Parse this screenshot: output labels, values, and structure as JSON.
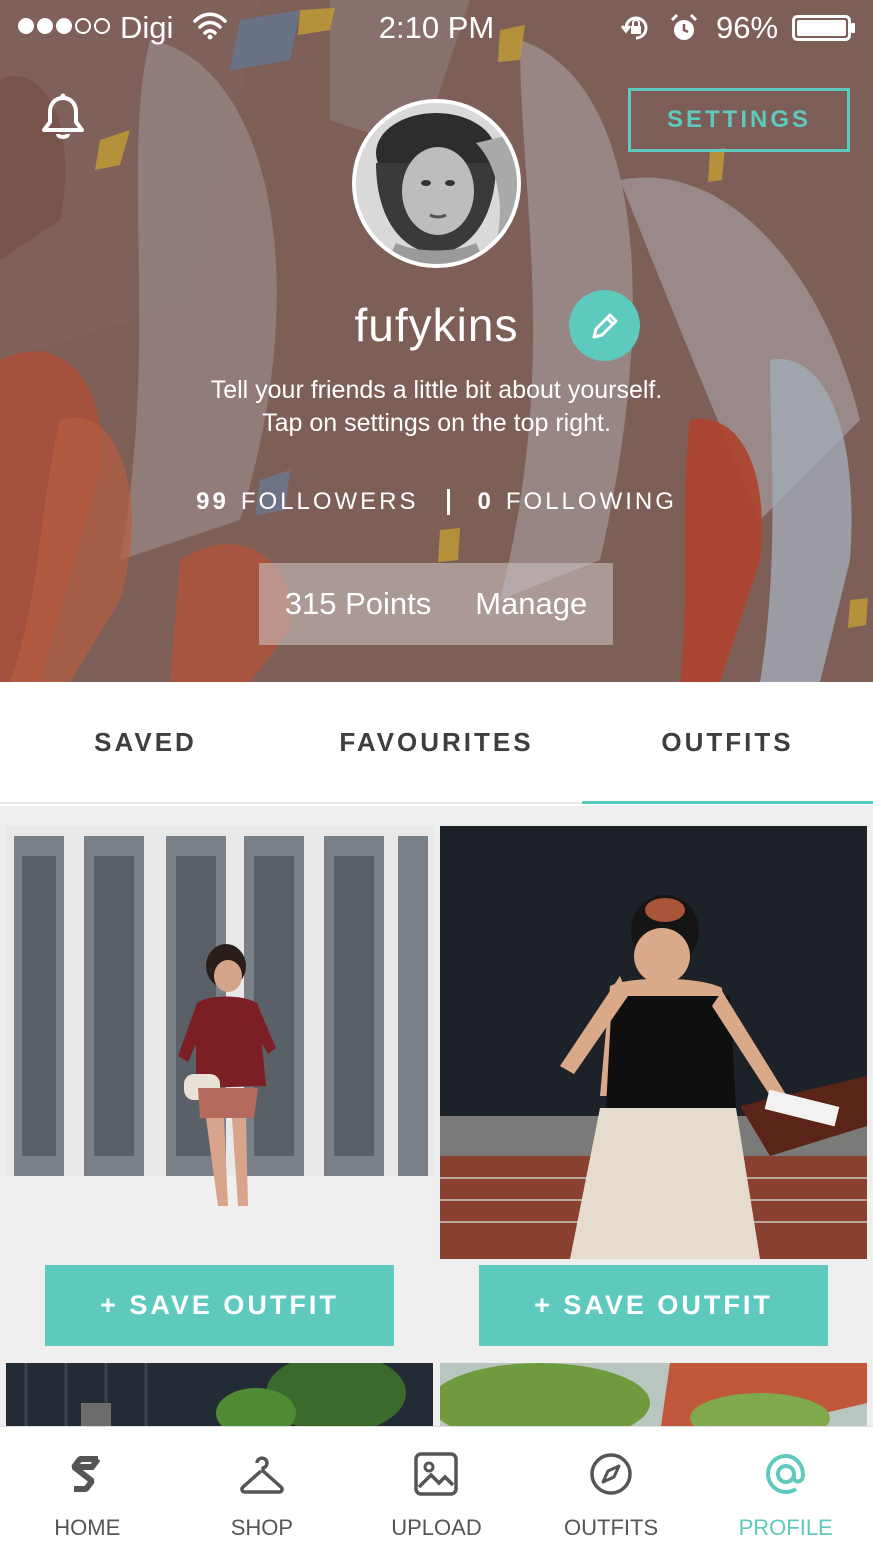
{
  "status_bar": {
    "carrier": "Digi",
    "time": "2:10 PM",
    "battery": "96%",
    "signal_bars_filled": 3,
    "signal_bars_total": 5
  },
  "header": {
    "settings_label": "SETTINGS",
    "username": "fufykins",
    "bio_line1": "Tell your friends a little bit about yourself.",
    "bio_line2": "Tap on settings on the top right.",
    "followers_count": "99",
    "followers_label": "FOLLOWERS",
    "following_count": "0",
    "following_label": "FOLLOWING",
    "points": "315 Points",
    "manage_label": "Manage"
  },
  "tabs": [
    {
      "label": "SAVED",
      "active": false
    },
    {
      "label": "FAVOURITES",
      "active": false
    },
    {
      "label": "OUTFITS",
      "active": true
    }
  ],
  "outfits": [
    {
      "save_label": "+ SAVE OUTFIT"
    },
    {
      "save_label": "+ SAVE OUTFIT"
    }
  ],
  "bottom_nav": [
    {
      "label": "HOME",
      "icon": "s-logo-icon",
      "active": false
    },
    {
      "label": "SHOP",
      "icon": "hanger-icon",
      "active": false
    },
    {
      "label": "UPLOAD",
      "icon": "image-upload-icon",
      "active": false
    },
    {
      "label": "OUTFITS",
      "icon": "compass-icon",
      "active": false
    },
    {
      "label": "PROFILE",
      "icon": "at-sign-icon",
      "active": true
    }
  ],
  "colors": {
    "accent": "#5ec9bd",
    "tab_text": "#3e3e3e",
    "nav_text": "#555555"
  }
}
